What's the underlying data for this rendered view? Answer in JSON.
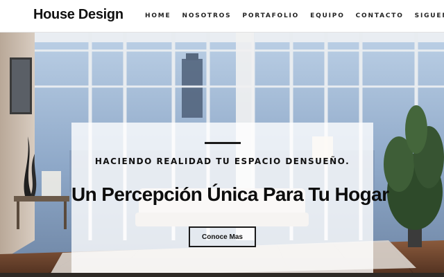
{
  "brand": {
    "logo_text": "House Design"
  },
  "nav": {
    "items": [
      {
        "label": "HOME"
      },
      {
        "label": "NOSOTROS"
      },
      {
        "label": "PORTAFOLIO"
      },
      {
        "label": "EQUIPO"
      },
      {
        "label": "CONTACTO"
      },
      {
        "label": "SIGUENOS"
      }
    ]
  },
  "hero": {
    "background_image": "living-room-city-view",
    "tagline": "HACIENDO REALIDAD TU ESPACIO DENSUEÑO.",
    "headline": "Un Percepción Única Para Tu Hogar",
    "cta_label": "Conoce Mas"
  },
  "colors": {
    "nav_background": "#ffffff",
    "text_primary": "#111111",
    "card_overlay": "rgba(255,255,255,0.80)",
    "sky_blue": "#8aa5c6",
    "floor_wood": "#6e4630"
  }
}
